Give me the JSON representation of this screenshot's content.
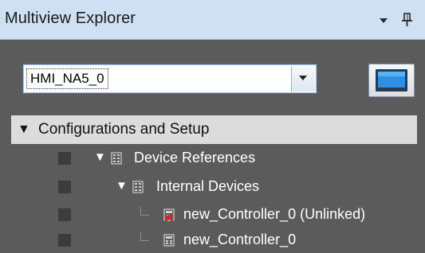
{
  "panel": {
    "title": "Multiview Explorer"
  },
  "device_selector": {
    "selected": "HMI_NA5_0"
  },
  "section": {
    "label": "Configurations and Setup",
    "expander": "▼"
  },
  "tree": [
    {
      "label": "Device References",
      "expander": "▼",
      "icon": "device-references-icon"
    },
    {
      "label": "Internal Devices",
      "expander": "▼",
      "icon": "internal-devices-icon"
    },
    {
      "label": "new_Controller_0 (Unlinked)",
      "icon": "unlinked-controller-icon"
    },
    {
      "label": "new_Controller_0",
      "icon": "controller-icon"
    }
  ]
}
